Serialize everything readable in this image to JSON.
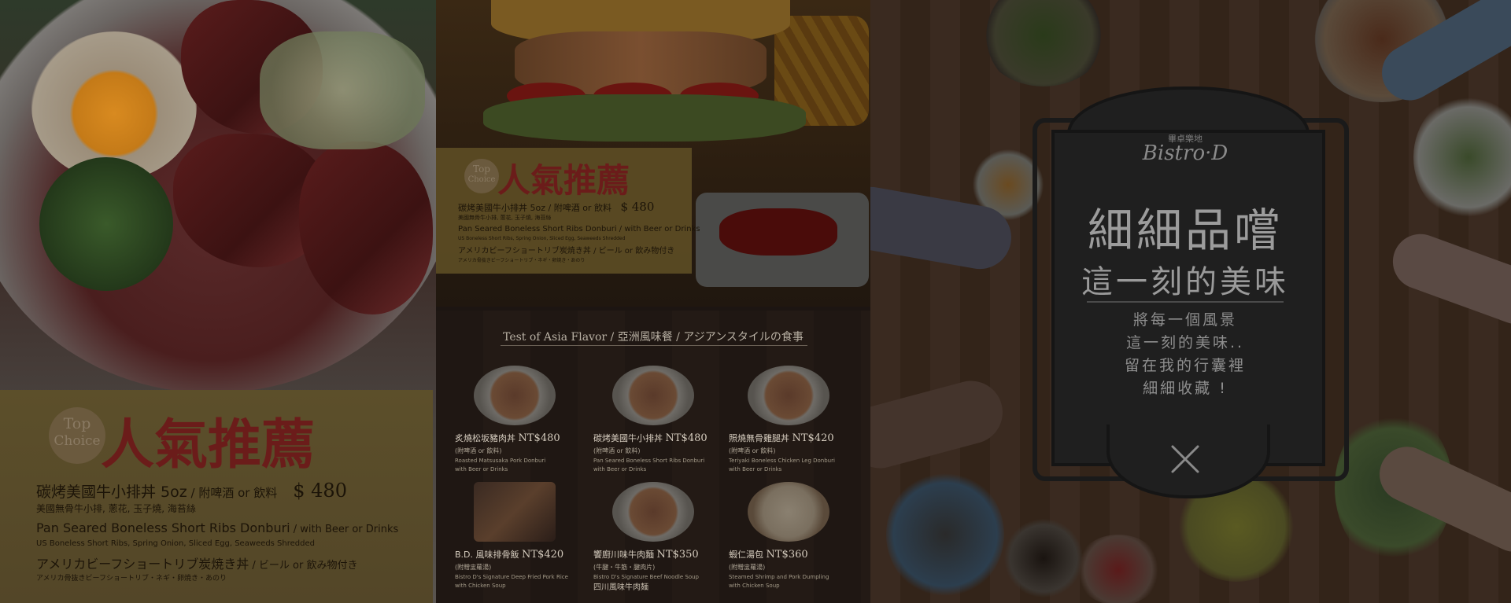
{
  "left_panel": {
    "badge": {
      "line1": "Top",
      "line2": "Choice"
    },
    "title": "人氣推薦",
    "line1_main": "碳烤美國牛小排丼 5oz",
    "line1_tail": " / 附啤酒 or 飲料",
    "price": "$ 480",
    "line2": "美國無骨牛小排, 蔥花, 玉子燒, 海苔絲",
    "line3_main": "Pan Seared Boneless Short Ribs Donburi",
    "line3_tail": " / with Beer or Drinks",
    "line4": "US Boneless Short Ribs, Spring Onion, Sliced Egg, Seaweeds Shredded",
    "line5_main": "アメリカビーフショートリブ炭焼き丼",
    "line5_tail": " / ビール or 飲み物付き",
    "line6": "アメリカ骨抜きビーフショートリブ・ネギ・卵焼き・あのり"
  },
  "middle_panel": {
    "promo": {
      "badge": {
        "line1": "Top",
        "line2": "Choice"
      },
      "title": "人氣推薦",
      "line1": "碳烤美國牛小排丼 5oz / 附啤酒 or 飲料",
      "price": "$ 480",
      "line2": "美國無骨牛小排, 蔥花, 玉子燒, 海苔絲",
      "line3": "Pan Seared Boneless Short Ribs Donburi / with Beer or Drinks",
      "line4": "US Boneless Short Ribs, Spring Onion, Sliced Egg, Seaweeds Shredded",
      "line5": "アメリカビーフショートリブ炭焼き丼 / ビール or 飲み物付き",
      "line6": "アメリカ骨抜きビーフショートリブ・ネギ・卵焼き・あのり"
    },
    "menu_heading": "Test of Asia Flavor / 亞洲風味餐 / アジアンスタイルの食事",
    "dishes": [
      {
        "name": "炙燒松坂豬肉丼",
        "price": "NT$480",
        "sub": "(附啤酒 or 飲料)",
        "en": "Roasted Matsusaka Pork Donburi",
        "en2": "with Beer or Drinks",
        "extra": ""
      },
      {
        "name": "碳烤美國牛小排丼",
        "price": "NT$480",
        "sub": "(附啤酒 or 飲料)",
        "en": "Pan Seared Boneless Short Ribs Donburi",
        "en2": "with Beer or Drinks",
        "extra": ""
      },
      {
        "name": "照燒無骨雞腿丼",
        "price": "NT$420",
        "sub": "(附啤酒 or 飲料)",
        "en": "Teriyaki Boneless Chicken Leg Donburi",
        "en2": "with Beer or Drinks",
        "extra": ""
      },
      {
        "name": "B.D. 風味排骨飯",
        "price": "NT$420",
        "sub": "(附贈盅蘿湯)",
        "en": "Bistro D's Signature Deep Fried Pork Rice",
        "en2": "with Chicken Soup",
        "extra": ""
      },
      {
        "name": "饗廚川味牛肉麵",
        "price": "NT$350",
        "sub": "(牛腱・牛筋・腱肉片)",
        "en": "Bistro D's Signature Beef Noodle Soup",
        "en2": "",
        "extra": "四川風味牛肉麺"
      },
      {
        "name": "蝦仁湯包",
        "price": "NT$360",
        "sub": "(附贈盅蘿湯)",
        "en": "Steamed Shrimp and Pork Dumpling",
        "en2": "with Chicken Soup",
        "extra": ""
      }
    ]
  },
  "right_panel": {
    "brand_small": "畢卓樂地",
    "brand_logo": "Bistro·D",
    "headline1": "細細品嚐",
    "headline2": "這一刻的美味",
    "poem": [
      "將每一個風景",
      "這一刻的美味..",
      "留在我的行囊裡",
      "細細收藏 !"
    ]
  },
  "colors": {
    "promo_red": "#6b1c1a",
    "promo_gold": "#5c4f2a",
    "board": "#1f1f1f"
  }
}
